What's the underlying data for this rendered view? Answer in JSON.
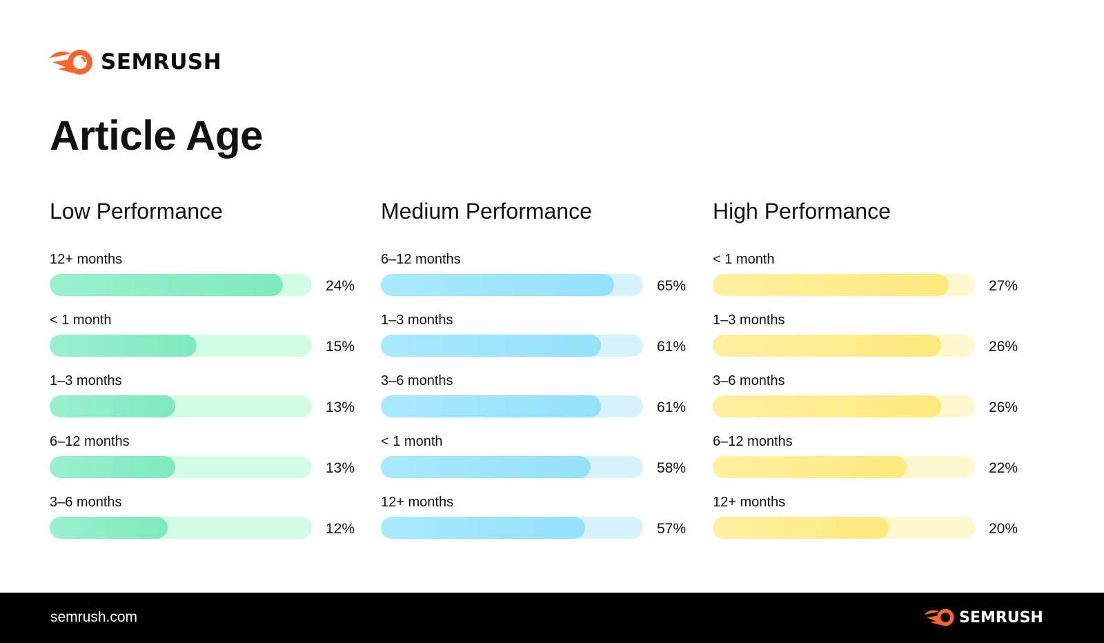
{
  "brand": {
    "name": "SEMRUSH",
    "accent": "#ff642d"
  },
  "title": "Article Age",
  "footer": {
    "site": "semrush.com",
    "brand": "SEMRUSH"
  },
  "chart_data": [
    {
      "type": "bar",
      "title": "Low Performance",
      "color": "#7deabf",
      "track_color": "#d1fde5",
      "categories": [
        "12+ months",
        "< 1 month",
        "1–3 months",
        "6–12 months",
        "3–6 months"
      ],
      "values": [
        24,
        15,
        13,
        13,
        12
      ],
      "labels": [
        "24%",
        "15%",
        "13%",
        "13%",
        "12%"
      ],
      "fill": [
        0.89,
        0.56,
        0.48,
        0.48,
        0.45
      ]
    },
    {
      "type": "bar",
      "title": "Medium Performance",
      "color": "#93e1fb",
      "track_color": "#d6f3fd",
      "categories": [
        "6–12 months",
        "1–3 months",
        "3–6 months",
        "< 1 month",
        "12+ months"
      ],
      "values": [
        65,
        61,
        61,
        58,
        57
      ],
      "labels": [
        "65%",
        "61%",
        "61%",
        "58%",
        "57%"
      ],
      "fill": [
        0.89,
        0.84,
        0.84,
        0.8,
        0.78
      ]
    },
    {
      "type": "bar",
      "title": "High Performance",
      "color": "#ffe97c",
      "track_color": "#fff7cd",
      "categories": [
        "< 1 month",
        "1–3 months",
        "3–6 months",
        "6–12 months",
        "12+ months"
      ],
      "values": [
        27,
        26,
        26,
        22,
        20
      ],
      "labels": [
        "27%",
        "26%",
        "26%",
        "22%",
        "20%"
      ],
      "fill": [
        0.9,
        0.87,
        0.87,
        0.74,
        0.67
      ]
    }
  ]
}
